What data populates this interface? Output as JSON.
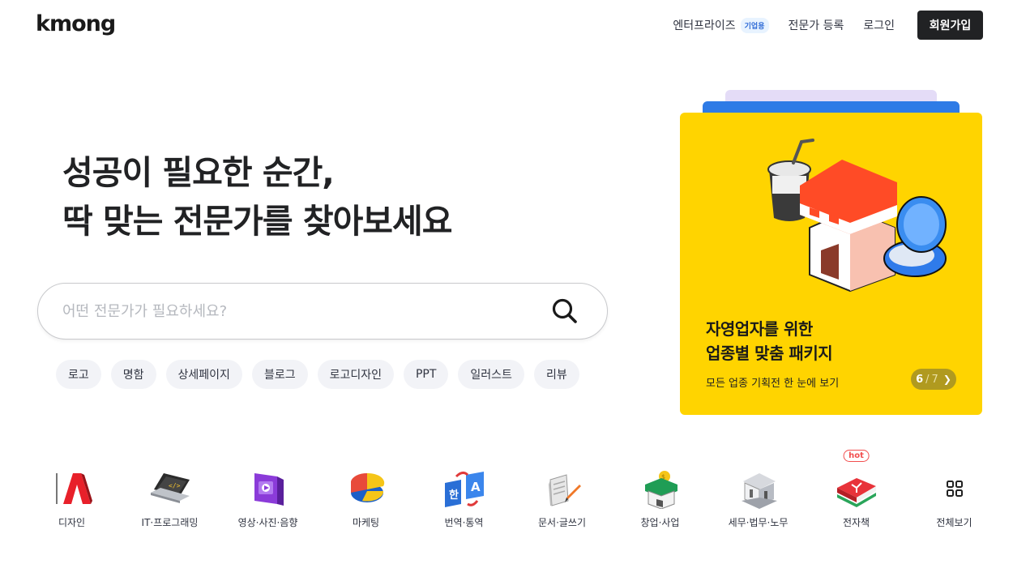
{
  "header": {
    "logo": "kmong",
    "nav": {
      "enterprise": "엔터프라이즈",
      "enterprise_badge": "기업용",
      "register_expert": "전문가 등록",
      "login": "로그인",
      "signup": "회원가입"
    }
  },
  "hero": {
    "title_line1": "성공이 필요한 순간,",
    "title_line2": "딱 맞는 전문가를 찾아보세요",
    "search_placeholder": "어떤 전문가가 필요하세요?",
    "search_value": "",
    "chips": [
      "로고",
      "명함",
      "상세페이지",
      "블로그",
      "로고디자인",
      "PPT",
      "일러스트",
      "리뷰"
    ]
  },
  "banner": {
    "title_line1": "자영업자를 위한",
    "title_line2": "업종별 맞춤 패키지",
    "subtitle": "모든 업종 기획전 한 눈에 보기",
    "page_current": "6",
    "page_separator": "/",
    "page_total": "7",
    "bg_color": "#ffd400"
  },
  "categories": [
    {
      "label": "디자인",
      "icon": "design-icon"
    },
    {
      "label": "IT·프로그래밍",
      "icon": "laptop-icon"
    },
    {
      "label": "영상·사진·음향",
      "icon": "video-icon"
    },
    {
      "label": "마케팅",
      "icon": "pie-chart-icon"
    },
    {
      "label": "번역·통역",
      "icon": "translate-icon"
    },
    {
      "label": "문서·글쓰기",
      "icon": "document-icon"
    },
    {
      "label": "창업·사업",
      "icon": "store-icon"
    },
    {
      "label": "세무·법무·노무",
      "icon": "building-icon"
    },
    {
      "label": "전자책",
      "icon": "book-icon",
      "badge": "hot"
    },
    {
      "label": "전체보기",
      "icon": "grid-icon"
    }
  ]
}
